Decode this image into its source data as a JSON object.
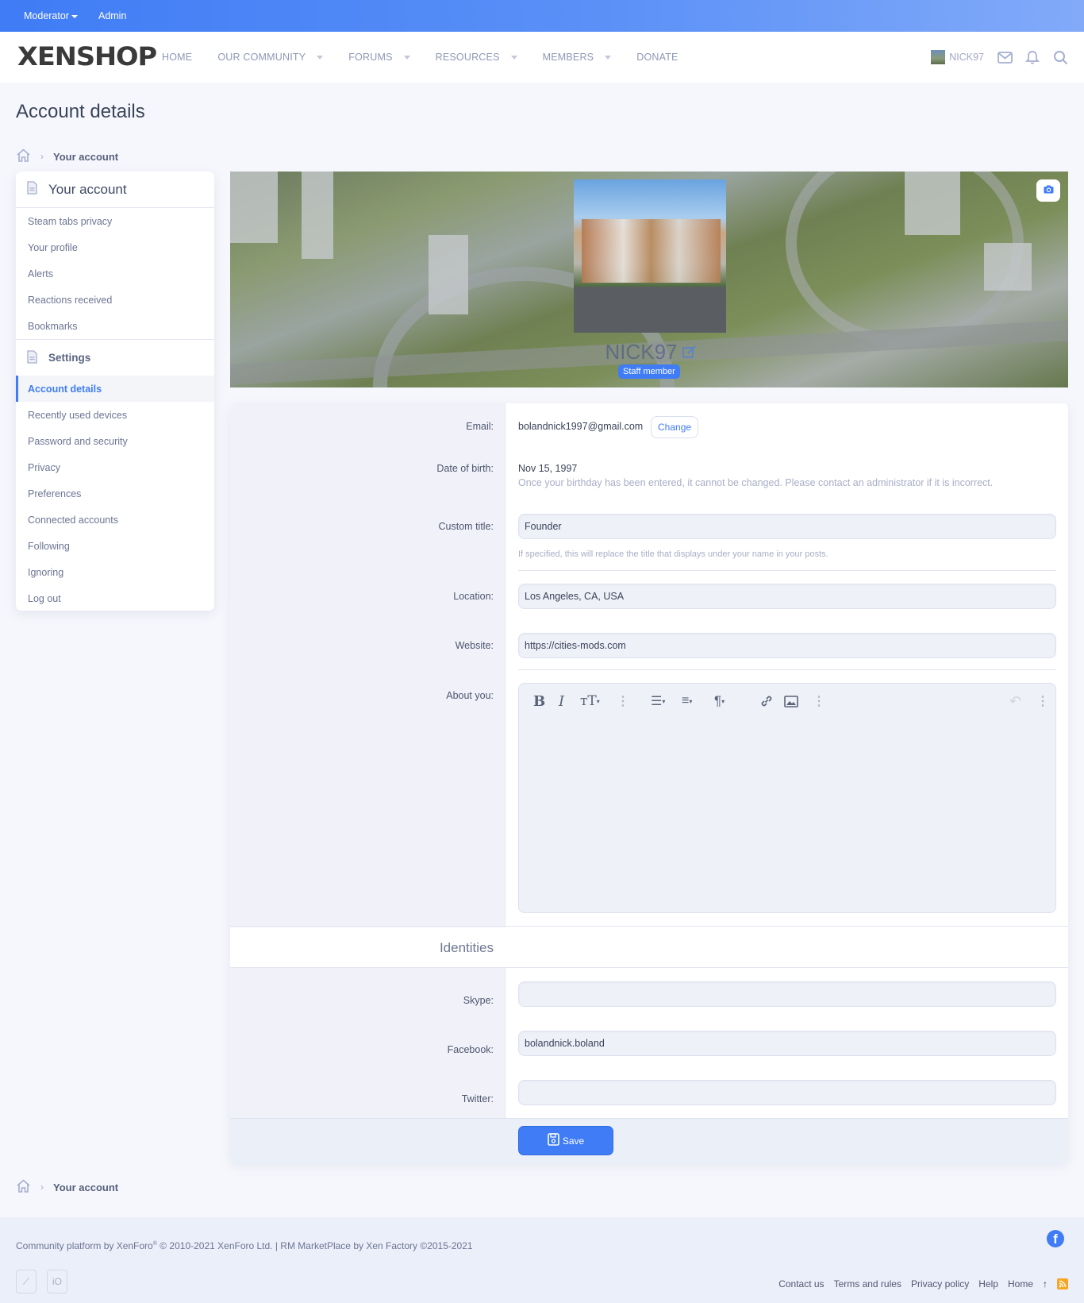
{
  "topbar": {
    "moderator": "Moderator",
    "admin": "Admin"
  },
  "nav": {
    "logo": "XENSHOP",
    "items": [
      {
        "label": "HOME",
        "dropdown": false
      },
      {
        "label": "OUR COMMUNITY",
        "dropdown": true
      },
      {
        "label": "FORUMS",
        "dropdown": true
      },
      {
        "label": "RESOURCES",
        "dropdown": true
      },
      {
        "label": "MEMBERS",
        "dropdown": true
      },
      {
        "label": "DONATE",
        "dropdown": false
      }
    ],
    "username": "NICK97",
    "icons": [
      "inbox-icon",
      "bell-icon",
      "search-icon"
    ]
  },
  "page": {
    "title": "Account details"
  },
  "breadcrumb": {
    "home_icon": "home-icon",
    "items": [
      "Your account"
    ]
  },
  "sidebar": {
    "your_account_header": "Your account",
    "account_items": [
      "Steam tabs privacy",
      "Your profile",
      "Alerts",
      "Reactions received",
      "Bookmarks"
    ],
    "settings_header": "Settings",
    "settings_items": [
      "Account details",
      "Recently used devices",
      "Password and security",
      "Privacy",
      "Preferences",
      "Connected accounts",
      "Following",
      "Ignoring",
      "Log out"
    ],
    "active_item": "Account details"
  },
  "profile": {
    "name": "NICK97",
    "badge": "Staff member"
  },
  "form": {
    "email_label": "Email:",
    "email_value": "bolandnick1997@gmail.com",
    "change_label": "Change",
    "dob_label": "Date of birth:",
    "dob_value": "Nov 15, 1997",
    "dob_hint": "Once your birthday has been entered, it cannot be changed. Please contact an administrator if it is incorrect.",
    "custom_title_label": "Custom title:",
    "custom_title_value": "Founder",
    "custom_title_hint": "If specified, this will replace the title that displays under your name in your posts.",
    "location_label": "Location:",
    "location_value": "Los Angeles, CA, USA",
    "website_label": "Website:",
    "website_value": "https://cities-mods.com",
    "about_label": "About you:",
    "about_value": "",
    "identities_header": "Identities",
    "skype_label": "Skype:",
    "skype_value": "",
    "facebook_label": "Facebook:",
    "facebook_value": "bolandnick.boland",
    "twitter_label": "Twitter:",
    "twitter_value": "",
    "save_label": "Save"
  },
  "editor_toolbar": [
    "bold",
    "italic",
    "font-size",
    "more",
    "list",
    "align",
    "paragraph",
    "link",
    "image",
    "more",
    "undo",
    "more"
  ],
  "footer": {
    "copyright_prefix": "Community platform by XenForo",
    "reg": "®",
    "copyright_suffix": " © 2010-2021 XenForo Ltd. | RM MarketPlace by Xen Factory ©2015-2021",
    "btn1": "",
    "btn2": "iO",
    "links": [
      "Contact us",
      "Terms and rules",
      "Privacy policy",
      "Help",
      "Home"
    ]
  },
  "colors": {
    "accent": "#3f7cf5",
    "rss": "#f5a623"
  }
}
